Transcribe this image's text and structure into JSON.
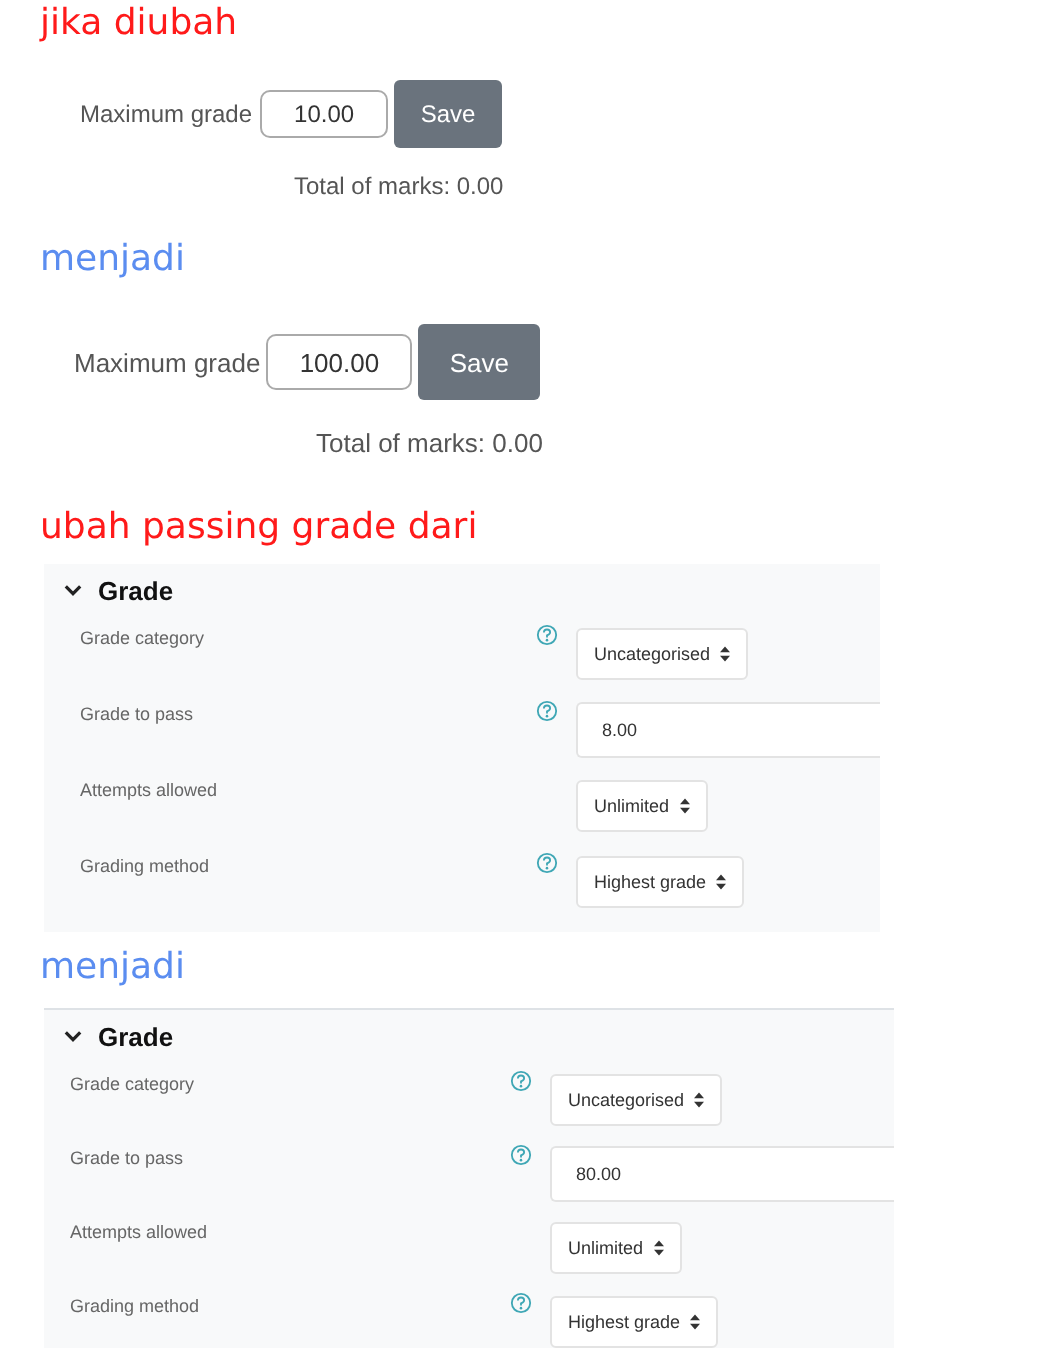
{
  "sections": [
    {
      "kind": "heading",
      "text": "jika diubah",
      "color": "#ff1a1a"
    },
    {
      "kind": "max_grade",
      "label": "Maximum grade",
      "value": "10.00",
      "button": "Save",
      "total": "Total of marks: 0.00"
    },
    {
      "kind": "heading",
      "text": "menjadi",
      "color": "#5b8df0"
    },
    {
      "kind": "max_grade",
      "label": "Maximum grade",
      "value": "100.00",
      "button": "Save",
      "total": "Total of marks: 0.00"
    },
    {
      "kind": "heading",
      "text": "ubah passing grade dari",
      "color": "#ff1a1a"
    },
    {
      "kind": "grade_panel",
      "title": "Grade",
      "expanded": true,
      "fields": [
        {
          "label": "Grade category",
          "help": true,
          "kind": "select",
          "value": "Uncategorised"
        },
        {
          "label": "Grade to pass",
          "help": true,
          "kind": "text",
          "value": "8.00"
        },
        {
          "label": "Attempts allowed",
          "help": false,
          "kind": "select",
          "value": "Unlimited"
        },
        {
          "label": "Grading method",
          "help": true,
          "kind": "select",
          "value": "Highest grade"
        }
      ]
    },
    {
      "kind": "heading",
      "text": "menjadi",
      "color": "#5b8df0"
    },
    {
      "kind": "grade_panel",
      "title": "Grade",
      "expanded": true,
      "fields": [
        {
          "label": "Grade category",
          "help": true,
          "kind": "select",
          "value": "Uncategorised"
        },
        {
          "label": "Grade to pass",
          "help": true,
          "kind": "text",
          "value": "80.00"
        },
        {
          "label": "Attempts allowed",
          "help": false,
          "kind": "select",
          "value": "Unlimited"
        },
        {
          "label": "Grading method",
          "help": true,
          "kind": "select",
          "value": "Highest grade"
        }
      ]
    }
  ]
}
